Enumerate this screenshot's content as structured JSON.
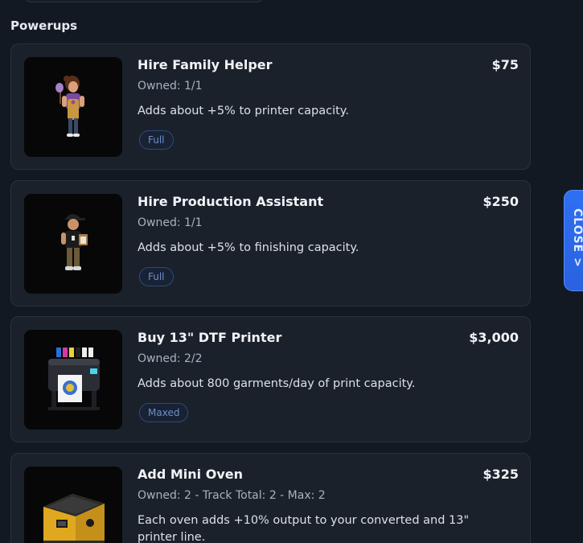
{
  "section_title": "Powerups",
  "close_label": "CLOSE >",
  "colors": {
    "accent": "#2f6ff2",
    "card_bg": "#1a212b",
    "page_bg": "#131922",
    "badge_text": "#6f8fc6"
  },
  "powerups": [
    {
      "name": "Hire Family Helper",
      "price": "$75",
      "owned": "Owned: 1/1",
      "description": "Adds about +5% to printer capacity.",
      "status": "Full",
      "icon": "family-helper-icon"
    },
    {
      "name": "Hire Production Assistant",
      "price": "$250",
      "owned": "Owned: 1/1",
      "description": "Adds about +5% to finishing capacity.",
      "status": "Full",
      "icon": "production-assistant-icon"
    },
    {
      "name": "Buy 13\" DTF Printer",
      "price": "$3,000",
      "owned": "Owned: 2/2",
      "description": "Adds about 800 garments/day of print capacity.",
      "status": "Maxed",
      "icon": "dtf-printer-icon"
    },
    {
      "name": "Add Mini Oven",
      "price": "$325",
      "owned": "Owned: 2 - Track Total: 2 - Max: 2",
      "description": "Each oven adds +10% output to your converted and 13\" printer line.",
      "status": "",
      "icon": "mini-oven-icon"
    }
  ]
}
